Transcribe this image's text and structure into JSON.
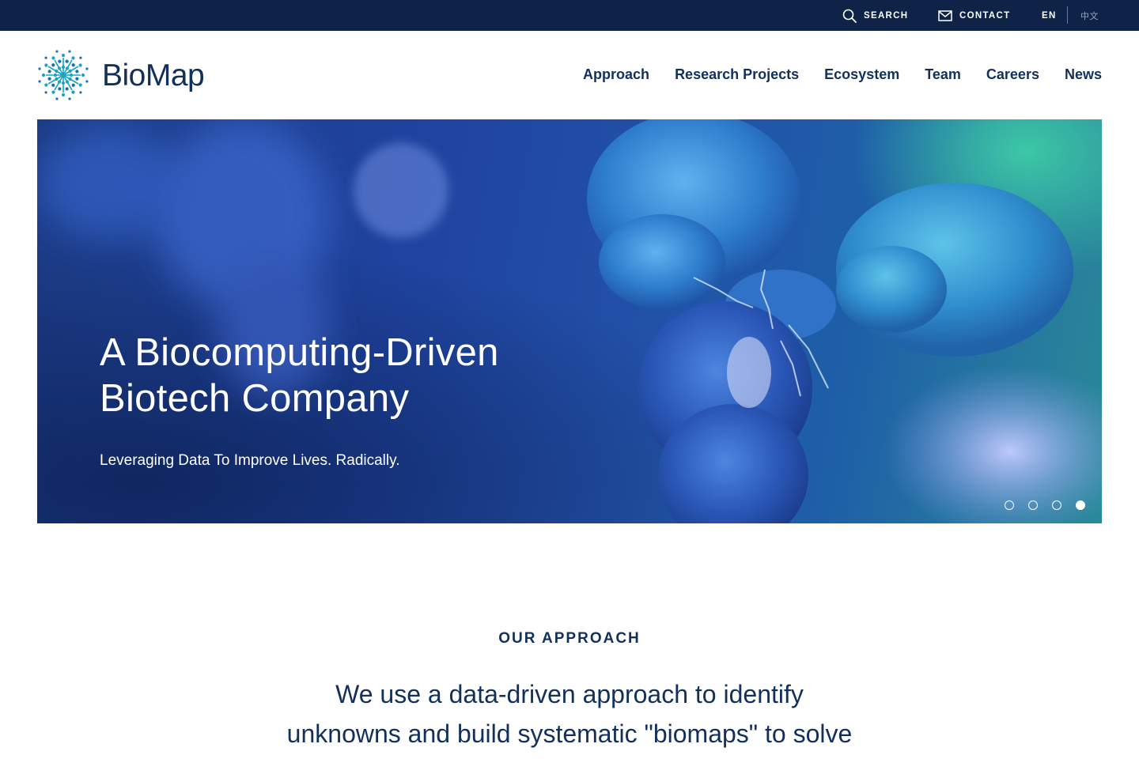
{
  "topbar": {
    "search_label": "SEARCH",
    "contact_label": "CONTACT",
    "lang_en": "EN",
    "lang_zh": "中文"
  },
  "header": {
    "logo_text": "BioMap",
    "nav": [
      "Approach",
      "Research Projects",
      "Ecosystem",
      "Team",
      "Careers",
      "News"
    ]
  },
  "hero": {
    "title_line1": "A Biocomputing-Driven",
    "title_line2": "Biotech Company",
    "subtitle": "Leveraging Data To Improve Lives. Radically.",
    "slide_count": 4,
    "active_slide": 4
  },
  "approach": {
    "label": "OUR APPROACH",
    "text_line1": "We use a data-driven approach to identify",
    "text_line2": "unknowns and build systematic \"biomaps\" to solve"
  },
  "colors": {
    "topbar_bg": "#0e2347",
    "brand_navy": "#12305c",
    "logo_teal": "#1aa3c8",
    "hero_blue": "#1f43a0"
  },
  "icons": {
    "search": "search-icon",
    "contact": "mail-icon",
    "logo": "biomap-snowflake-logo-icon"
  }
}
